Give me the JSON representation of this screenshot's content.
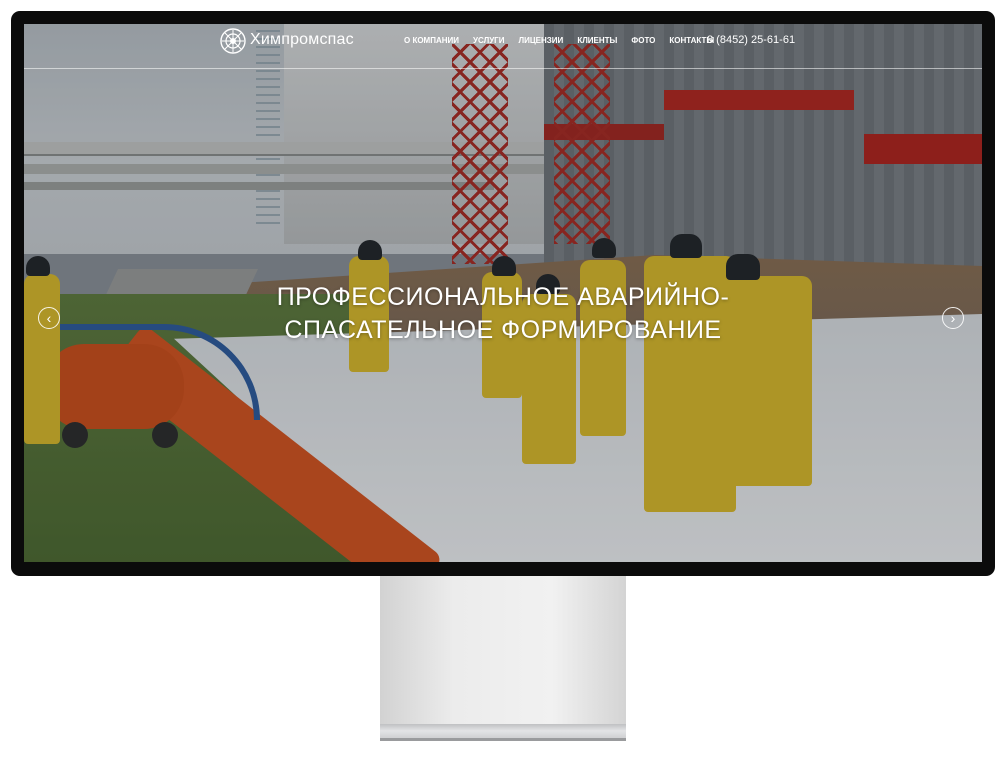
{
  "site": {
    "logo_text": "Химпромспас",
    "logo_icon": "emblem-icon"
  },
  "nav": {
    "items": [
      {
        "label": "о компании"
      },
      {
        "label": "услуги"
      },
      {
        "label": "лицензии"
      },
      {
        "label": "клиенты"
      },
      {
        "label": "фото"
      },
      {
        "label": "контакты"
      }
    ],
    "phone": "8 (8452) 25-61-61"
  },
  "hero": {
    "headline_line1": "ПРОФЕССИОНАЛЬНОЕ АВАРИЙНО-",
    "headline_line2": "СПАСАТЕЛЬНОЕ ФОРМИРОВАНИЕ",
    "prev_icon": "chevron-left-icon",
    "next_icon": "chevron-right-icon",
    "prev_glyph": "‹",
    "next_glyph": "›"
  },
  "colors": {
    "monitor_bezel": "#0b0b0b",
    "text": "#ffffff",
    "stand": "#e6e6e6"
  }
}
